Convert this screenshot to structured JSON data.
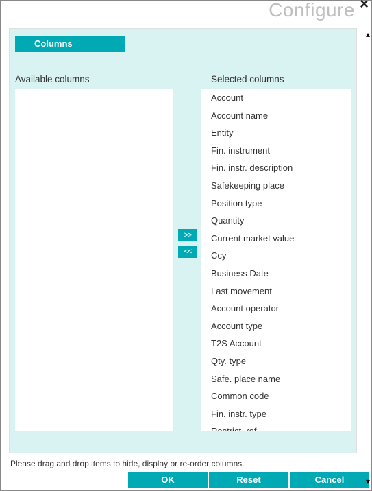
{
  "dialog": {
    "title": "Configure",
    "close_glyph": "×"
  },
  "tab": {
    "label": "Columns"
  },
  "labels": {
    "available": "Available columns",
    "selected": "Selected columns"
  },
  "move": {
    "right": ">>",
    "left": "<<"
  },
  "available_items": [],
  "selected_items": [
    "Account",
    "Account name",
    "Entity",
    "Fin. instrument",
    "Fin. instr. description",
    "Safekeeping place",
    "Position type",
    "Quantity",
    "Current market value",
    "Ccy",
    "Business Date",
    "Last movement",
    "Account operator",
    "Account type",
    "T2S Account",
    "Qty. type",
    "Safe. place name",
    "Common code",
    "Fin. instr. type",
    "Restrict. ref."
  ],
  "hint": "Please drag and drop items to hide, display or re-order columns.",
  "buttons": {
    "ok": "OK",
    "reset": "Reset",
    "cancel": "Cancel"
  },
  "scroll": {
    "up": "▴",
    "down": "▾"
  }
}
